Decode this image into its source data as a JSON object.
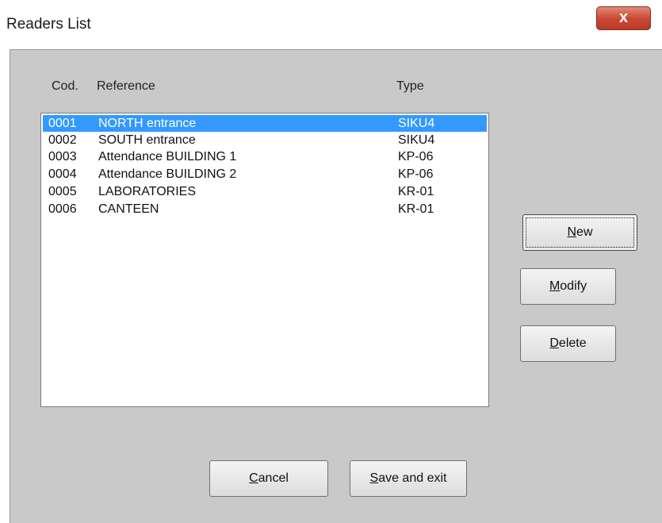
{
  "window": {
    "title": "Readers List",
    "close_glyph": "x"
  },
  "columns": {
    "code": "Cod.",
    "reference": "Reference",
    "type": "Type"
  },
  "readers": [
    {
      "code": "0001",
      "reference": "NORTH entrance",
      "type": "SIKU4",
      "selected": true
    },
    {
      "code": "0002",
      "reference": "SOUTH entrance",
      "type": "SIKU4",
      "selected": false
    },
    {
      "code": "0003",
      "reference": "Attendance BUILDING 1",
      "type": "KP-06",
      "selected": false
    },
    {
      "code": "0004",
      "reference": "Attendance BUILDING 2",
      "type": "KP-06",
      "selected": false
    },
    {
      "code": "0005",
      "reference": "LABORATORIES",
      "type": "KR-01",
      "selected": false
    },
    {
      "code": "0006",
      "reference": "CANTEEN",
      "type": "KR-01",
      "selected": false
    }
  ],
  "buttons": {
    "new": {
      "accel": "N",
      "rest": "ew"
    },
    "modify": {
      "accel": "M",
      "rest": "odify"
    },
    "delete": {
      "accel": "D",
      "rest": "elete"
    },
    "cancel": {
      "accel": "C",
      "rest": "ancel"
    },
    "save": {
      "accel": "S",
      "rest": "ave and exit"
    }
  },
  "colors": {
    "selection": "#3399ff",
    "dialog_background": "#c9c9c9",
    "close_button": "#cc4a35"
  },
  "icons": {
    "close": "close-icon"
  }
}
